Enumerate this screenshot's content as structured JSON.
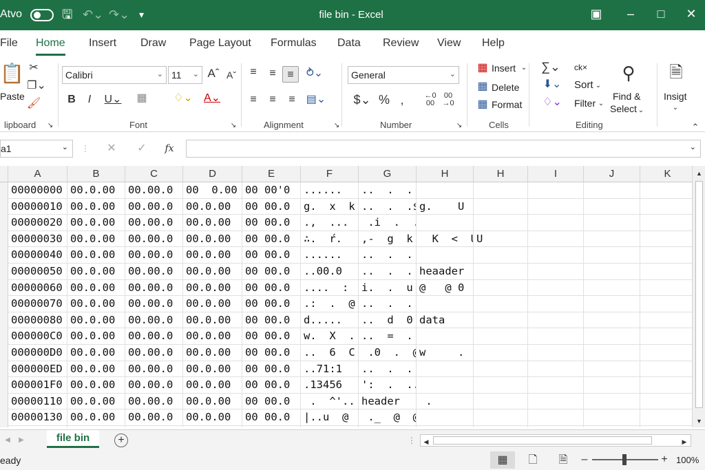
{
  "titlebar": {
    "autosave_label": "Atvo",
    "title": "file bin - Excel"
  },
  "tabs": [
    "File",
    "Home",
    "Insert",
    "Draw",
    "Page Layout",
    "Formulas",
    "Data",
    "Review",
    "View",
    "Help"
  ],
  "ribbon": {
    "clipboard": {
      "paste_label": "Paste",
      "group_label": "lipboard"
    },
    "font": {
      "font_name": "Calibri",
      "font_size": "11",
      "group_label": "Font"
    },
    "alignment": {
      "group_label": "Alignment"
    },
    "number": {
      "format": "General",
      "group_label": "Number"
    },
    "cells": {
      "insert_label": "Insert",
      "delete_label": "Delete",
      "format_label": "Format",
      "group_label": "Cells"
    },
    "editing": {
      "clear_label": "ck×",
      "sort_label": "Sort",
      "filter_label": "Filter",
      "find_label": "Find &",
      "select_label": "Select",
      "group_label": "Editing"
    },
    "insights": {
      "label": "Insigt"
    }
  },
  "formula_bar": {
    "name_box": "a1",
    "fx": "fx",
    "formula": ""
  },
  "columns": [
    "A",
    "B",
    "C",
    "D",
    "E",
    "F",
    "G",
    "H",
    "H",
    "I",
    "J",
    "K"
  ],
  "rows": [
    [
      "00000000",
      "00.0.00",
      "00.00.0",
      "00  0.00",
      "00 00'0",
      "......",
      "..  .  .",
      "",
      "",
      "",
      "",
      ""
    ],
    [
      "00000010",
      "00.0.00",
      "00.00.0",
      "00.0.00",
      "00 00.0",
      "g.  x  k",
      "..  .  .$",
      "g.    U",
      "",
      "",
      "",
      ""
    ],
    [
      "00000020",
      "00.0.00",
      "00.00.0",
      "00.0.00",
      "00 00.0",
      ".,  ...",
      " .i  .  .",
      "",
      "",
      "",
      "",
      ""
    ],
    [
      "00000030",
      "00.0.00",
      "00.00.0",
      "00.0.00",
      "00 00.0",
      "∴.  ŕ.",
      ",-  g  k",
      "  K  <  U",
      "U",
      "",
      "",
      ""
    ],
    [
      "00000040",
      "00.0.00",
      "00.00.0",
      "00.0.00",
      "00 00.0",
      "......",
      "..  .  .",
      "",
      "",
      "",
      "",
      ""
    ],
    [
      "00000050",
      "00.0.00",
      "00.00.0",
      "00.0.00",
      "00 00.0",
      "..00.0",
      "..  .  .",
      "heaader",
      "",
      "",
      "",
      ""
    ],
    [
      "00000060",
      "00.0.00",
      "00.00.0",
      "00.0.00",
      "00 00.0",
      "....  :",
      "i.  .  u",
      "@   @ 0",
      "",
      "",
      "",
      ""
    ],
    [
      "00000070",
      "00.0.00",
      "00.00.0",
      "00.0.00",
      "00 00.0",
      ".:  .  @",
      "..  .  .",
      "",
      "",
      "",
      "",
      ""
    ],
    [
      "00000080",
      "00.0.00",
      "00.00.0",
      "00.0.00",
      "00 00.0",
      "d.....",
      "..  d  0",
      "data",
      "",
      "",
      "",
      ""
    ],
    [
      "000000C0",
      "00.0.00",
      "00.00.0",
      "00.0.00",
      "00 00.0",
      "w.  X  .",
      "..  =  .",
      "",
      "",
      "",
      "",
      ""
    ],
    [
      "000000D0",
      "00.0.00",
      "00.00.0",
      "00.0.00",
      "00 00.0",
      "..  6  C",
      " .0  .  @",
      "w     .",
      "",
      "",
      "",
      ""
    ],
    [
      "000000ED",
      "00.0.00",
      "00.00.0",
      "00.0.00",
      "00 00.0",
      "..71:1",
      "..  .  .",
      "",
      "",
      "",
      "",
      ""
    ],
    [
      "000001F0",
      "00.0.00",
      "00.00.0",
      "00.0.00",
      "00 00.0",
      ".13456",
      "':  .  ..",
      "",
      "",
      "",
      "",
      ""
    ],
    [
      "00000110",
      "00.0.00",
      "00.00.0",
      "00.0.00",
      "00 00.0",
      " .  ^'..",
      "header",
      " .",
      "",
      "",
      "",
      ""
    ],
    [
      "00000130",
      "00.0.00",
      "00.00.0",
      "00.0.00",
      "00 00.0",
      "|..u  @",
      " ._  @  @",
      "",
      "",
      "",
      "",
      ""
    ]
  ],
  "sheet_tab": "file bin",
  "status": {
    "ready": "eady",
    "zoom": "100%"
  }
}
